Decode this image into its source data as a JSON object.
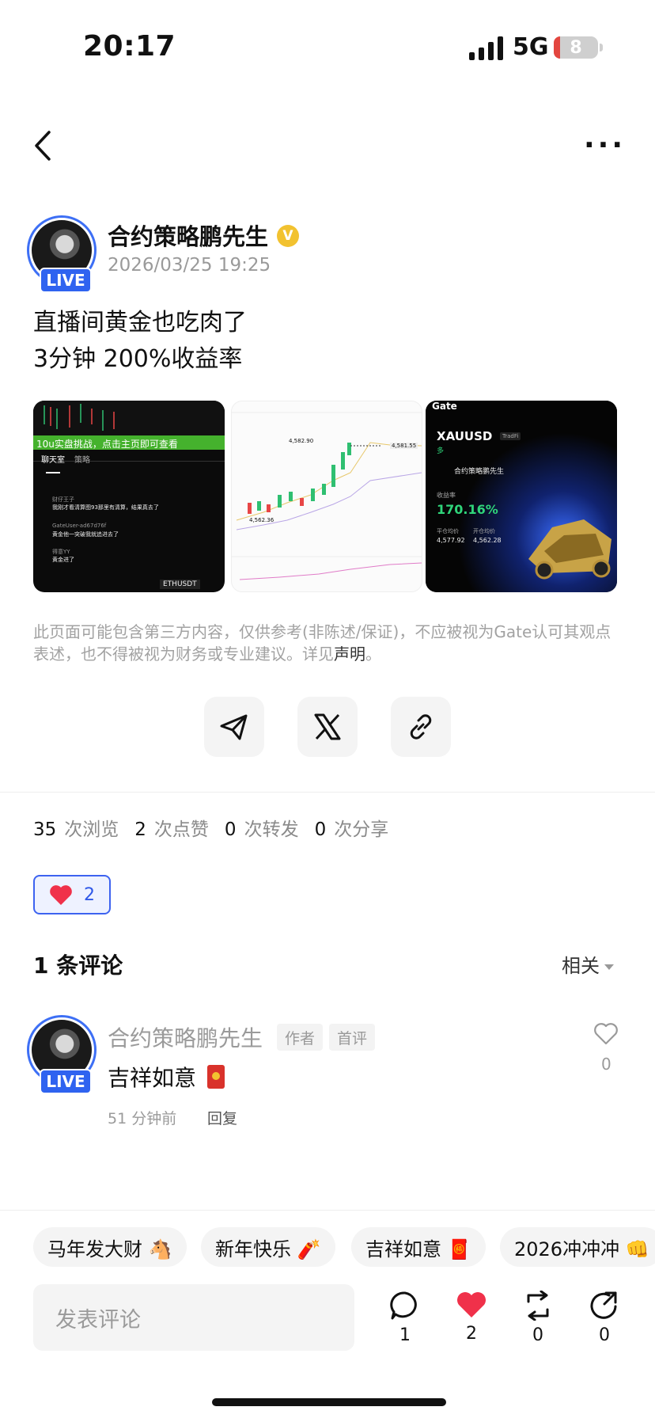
{
  "status": {
    "time": "20:17",
    "network": "5G",
    "battery": "8"
  },
  "author": {
    "name": "合约策略鹏先生",
    "date": "2026/03/25 19:25",
    "live_label": "LIVE",
    "verified_icon": "verified-badge-icon"
  },
  "post": {
    "line1": "直播间黄金也吃肉了",
    "line2": "3分钟 200%收益率"
  },
  "thumbnails": {
    "t1": {
      "banner": "10u实盘挑战，点击主页即可查看",
      "tab1": "聊天室",
      "tab2": "策略",
      "msg1": "我刚才看清算图93那里有清算，结果真去了",
      "msg2": "黄金他一突破我就追进去了",
      "msg3": "黄金进了",
      "user1": "财仔王子",
      "user2": "GateUser-ad67d76f",
      "user3": "得意YY",
      "pair": "ETHUSDT"
    },
    "t2": {
      "price_high": "4,582.90",
      "price_now": "4,581.55",
      "price_low": "4,562.36"
    },
    "t3": {
      "brand": "Gate",
      "symbol": "XAUUSD",
      "badge": "TradFi",
      "side": "多",
      "trader": "合约策略鹏先生",
      "yield_label": "收益率",
      "yield_value": "170.16%",
      "close_label": "平仓均价",
      "open_label": "开仓均价",
      "close_value": "4,577.92",
      "open_value": "4,562.28"
    }
  },
  "disclaimer": {
    "text": "此页面可能包含第三方内容，仅供参考(非陈述/保证)，不应被视为Gate认可其观点表述，也不得被视为财务或专业建议。详见",
    "link": "声明",
    "end": "。"
  },
  "stats": {
    "views_n": "35",
    "views_label": "次浏览",
    "likes_n": "2",
    "likes_label": "次点赞",
    "reposts_n": "0",
    "reposts_label": "次转发",
    "shares_n": "0",
    "shares_label": "次分享"
  },
  "like_button": {
    "count": "2"
  },
  "comments": {
    "title": "1 条评论",
    "sort": "相关",
    "items": [
      {
        "name": "合约策略鹏先生",
        "tag_author": "作者",
        "tag_first": "首评",
        "text": "吉祥如意",
        "time": "51 分钟前",
        "reply": "回复",
        "likes": "0",
        "live": "LIVE"
      }
    ]
  },
  "quick_replies": [
    "马年发大财 🐴",
    "新年快乐 🧨",
    "吉祥如意 🧧",
    "2026冲冲冲 👊"
  ],
  "bottom": {
    "input_placeholder": "发表评论",
    "comment_count": "1",
    "like_count": "2",
    "repost_count": "0",
    "share_count": "0"
  },
  "colors": {
    "accent": "#2f63f0",
    "heart": "#f0314a",
    "verified": "#f2c230",
    "gain": "#2fd47a"
  }
}
